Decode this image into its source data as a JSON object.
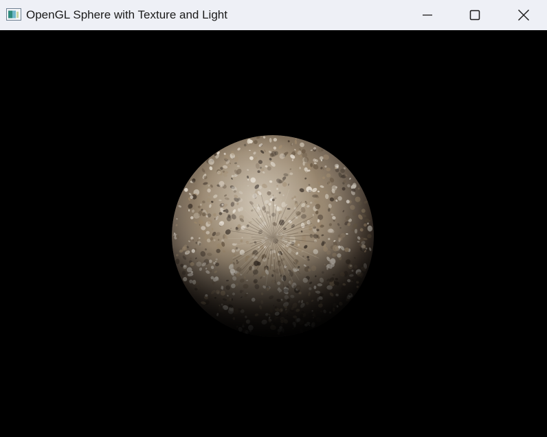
{
  "window": {
    "title": "OpenGL Sphere with Texture and Light",
    "app_icon": "opengl-app-icon",
    "controls": {
      "minimize_icon": "minimize-icon",
      "maximize_icon": "maximize-icon",
      "close_icon": "close-icon"
    }
  },
  "scene": {
    "background_color": "#000000",
    "object": "textured-sphere",
    "texture_colors": [
      "#d8cfc0",
      "#a08a6c",
      "#6b5a46",
      "#3a2f25",
      "#efe8dc"
    ]
  }
}
